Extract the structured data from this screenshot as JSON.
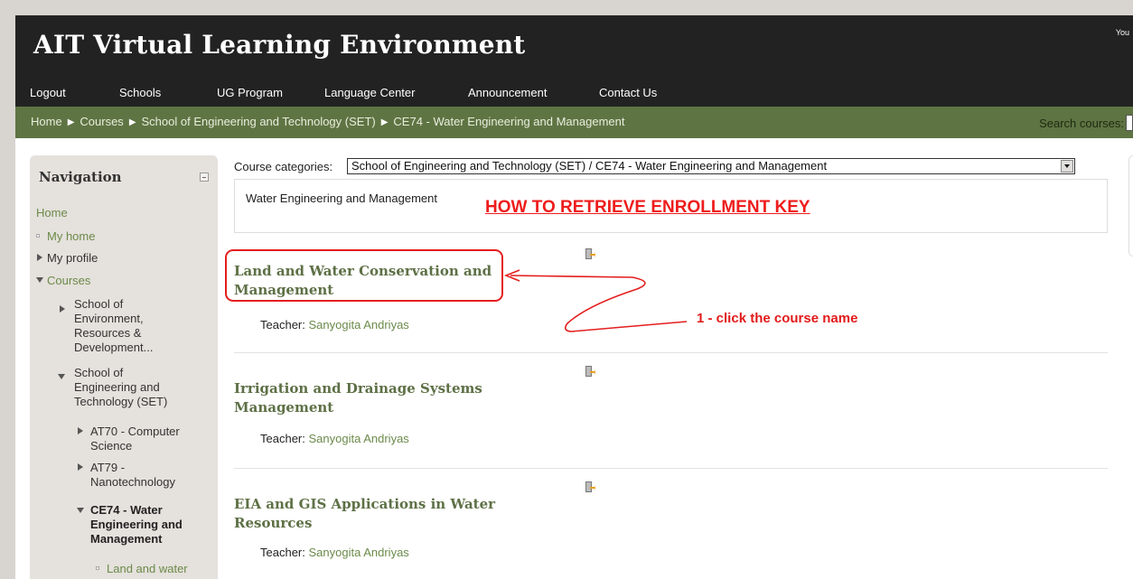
{
  "header": {
    "site_title": "AIT Virtual Learning Environment",
    "user_hint": "You",
    "menu": [
      "Logout",
      "Schools",
      "UG Program",
      "Language Center",
      "Announcement",
      "Contact Us"
    ]
  },
  "navbar": {
    "breadcrumbs": [
      "Home",
      "Courses",
      "School of Engineering and Technology (SET)",
      "CE74 - Water Engineering and Management"
    ],
    "search_label": "Search courses:"
  },
  "navigation": {
    "title": "Navigation",
    "home": "Home",
    "my_home": "My home",
    "my_profile": "My profile",
    "courses": "Courses",
    "serd": [
      "School of",
      "Environment,",
      "Resources &",
      "Development..."
    ],
    "set": [
      "School of",
      "Engineering and",
      "Technology (SET)"
    ],
    "at70": [
      "AT70 - Computer",
      "Science"
    ],
    "at79": [
      "AT79 -",
      "Nanotechnology"
    ],
    "ce74": [
      "CE74 - Water",
      "Engineering and",
      "Management"
    ],
    "land_water": "Land and water"
  },
  "main": {
    "category_label": "Course categories:",
    "category_selected": "School of Engineering and Technology (SET) / CE74 - Water Engineering and Management",
    "category_description": "Water Engineering and Management",
    "courses": [
      {
        "name": "Land and Water Conservation and Management",
        "teacher_label": "Teacher:",
        "teacher": "Sanyogita Andriyas"
      },
      {
        "name": "Irrigation and Drainage Systems Management",
        "teacher_label": "Teacher:",
        "teacher": "Sanyogita Andriyas"
      },
      {
        "name": "EIA and GIS Applications in Water Resources",
        "teacher_label": "Teacher:",
        "teacher": "Sanyogita Andriyas"
      }
    ]
  },
  "annotation": {
    "heading": "HOW TO RETRIEVE ENROLLMENT KEY",
    "step1": "1 - click the course name",
    "color": "#e41e1e"
  }
}
